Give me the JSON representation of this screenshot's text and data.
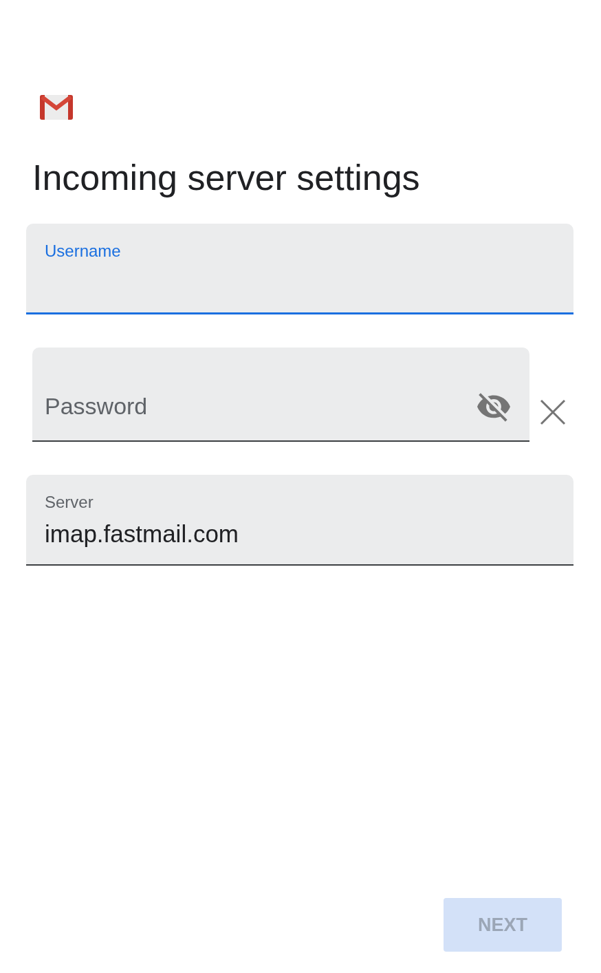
{
  "title": "Incoming server settings",
  "fields": [
    {
      "kind": "text",
      "label": "Username",
      "focused": true,
      "removable": false
    },
    {
      "kind": "password",
      "label": "Password",
      "focused": false,
      "removable": true,
      "password_visible": false
    },
    {
      "kind": "text",
      "label": "Server",
      "value": "imap.fastmail.com",
      "focused": false,
      "removable": false
    }
  ],
  "next_button": {
    "label": "NEXT",
    "disabled": true
  }
}
